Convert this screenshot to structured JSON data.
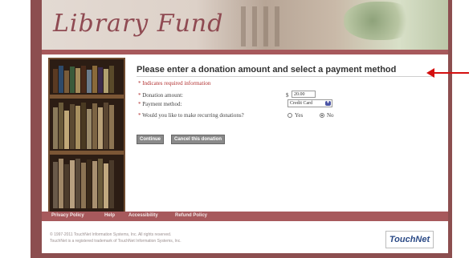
{
  "header": {
    "logo_text": "Library Fund"
  },
  "form": {
    "heading": "Please enter a donation amount and select a payment method",
    "required_note": "* Indicates required information",
    "donation_label": "Donation amount:",
    "currency_symbol": "$",
    "donation_value": "20.00",
    "payment_label": "Payment method:",
    "payment_value": "Credit Card",
    "recurring_label": "Would you like to make recurring donations?",
    "radio_yes": "Yes",
    "radio_no": "No",
    "recurring_selected": "No",
    "continue_button": "Continue",
    "cancel_button": "Cancel this donation"
  },
  "footer": {
    "links": [
      "Privacy Policy",
      "Help",
      "Accessibility",
      "Refund Policy"
    ],
    "copyright_1": "© 1997-2011 TouchNet Information Systems, Inc. All rights reserved.",
    "copyright_2": "TouchNet is a registered trademark of TouchNet Information Systems, Inc.",
    "brand": "TouchNet"
  },
  "colors": {
    "frame": "#8c4e4f",
    "accent_bar": "#a7595c",
    "annotation_arrow": "#d40f0f"
  }
}
